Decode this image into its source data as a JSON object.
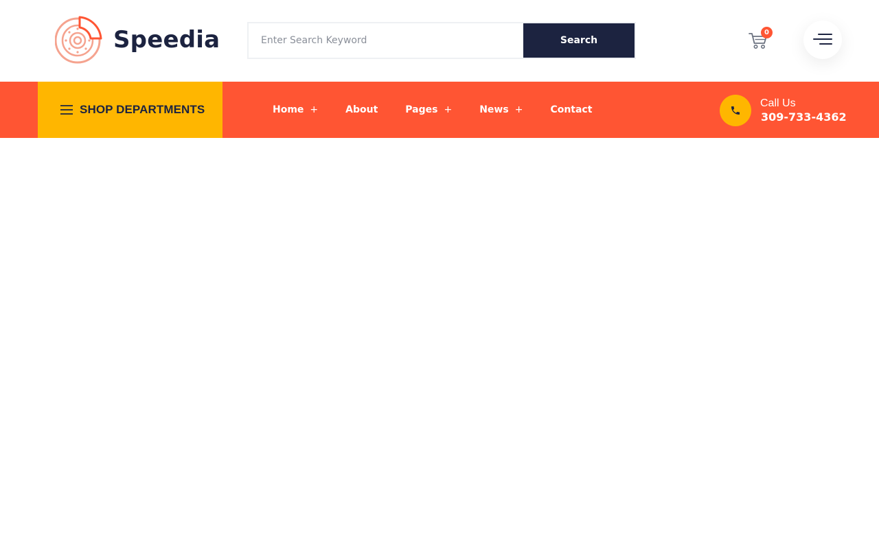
{
  "brand": {
    "name": "Speedia",
    "primary_color": "#ff5533",
    "accent_color": "#ffb600",
    "dark_color": "#1c2340",
    "logo_icon": "brake-disc-icon"
  },
  "search": {
    "placeholder": "Enter Search Keyword",
    "value": "",
    "button_label": "Search",
    "icon": "none"
  },
  "cart": {
    "icon": "cart-icon",
    "count": "0"
  },
  "menu_toggle": {
    "icon": "hamburger-icon"
  },
  "departments": {
    "icon": "hamburger-icon",
    "label": "SHOP DEPARTMENTS"
  },
  "nav": {
    "items": [
      {
        "label": "Home",
        "has_submenu": true,
        "indicator": "+"
      },
      {
        "label": "About",
        "has_submenu": false,
        "indicator": ""
      },
      {
        "label": "Pages",
        "has_submenu": true,
        "indicator": "+"
      },
      {
        "label": "News",
        "has_submenu": true,
        "indicator": "+"
      },
      {
        "label": "Contact",
        "has_submenu": false,
        "indicator": ""
      }
    ]
  },
  "call": {
    "icon": "phone-icon",
    "label": "Call Us",
    "number": "309-733-4362"
  }
}
